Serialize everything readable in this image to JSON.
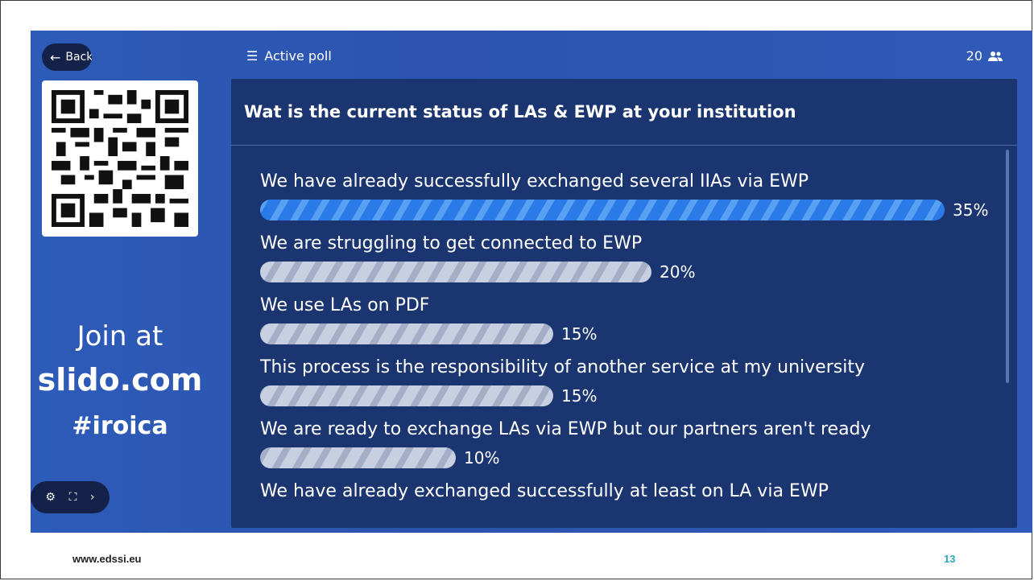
{
  "stage": {
    "back_label": "Back",
    "join_at": "Join at",
    "join_url": "slido.com",
    "event_code": "#iroica",
    "active_poll_label": "Active poll",
    "participant_count": "20"
  },
  "poll": {
    "question": "Wat is the current status of LAs & EWP at your institution",
    "options": [
      {
        "label": "We have already successfully exchanged several IIAs via EWP",
        "percent_text": "35%",
        "percent": 35,
        "winner": true
      },
      {
        "label": "We are struggling to get connected to EWP",
        "percent_text": "20%",
        "percent": 20,
        "winner": false
      },
      {
        "label": "We use LAs on PDF",
        "percent_text": "15%",
        "percent": 15,
        "winner": false
      },
      {
        "label": "This process is the responsibility of another service at my university",
        "percent_text": "15%",
        "percent": 15,
        "winner": false
      },
      {
        "label": "We are ready to exchange LAs via EWP but our partners aren't ready",
        "percent_text": "10%",
        "percent": 10,
        "winner": false
      },
      {
        "label": "We have already exchanged successfully at least on LA via EWP",
        "percent_text": "",
        "percent": null,
        "winner": false
      }
    ]
  },
  "footer": {
    "url": "www.edssi.eu",
    "page_number": "13"
  },
  "icons": {
    "back": "arrow-left-icon",
    "list": "list-icon",
    "people": "people-icon",
    "settings": "gear-icon",
    "fullscreen": "fullscreen-icon",
    "next": "chevron-right-icon"
  },
  "colors": {
    "stage_blue": "#2d5bb8",
    "panel_navy": "#1b3570",
    "winner_bar": "#2a7ae8",
    "bar_grey": "#c7cfe0",
    "page_number": "#2aa8b8"
  }
}
